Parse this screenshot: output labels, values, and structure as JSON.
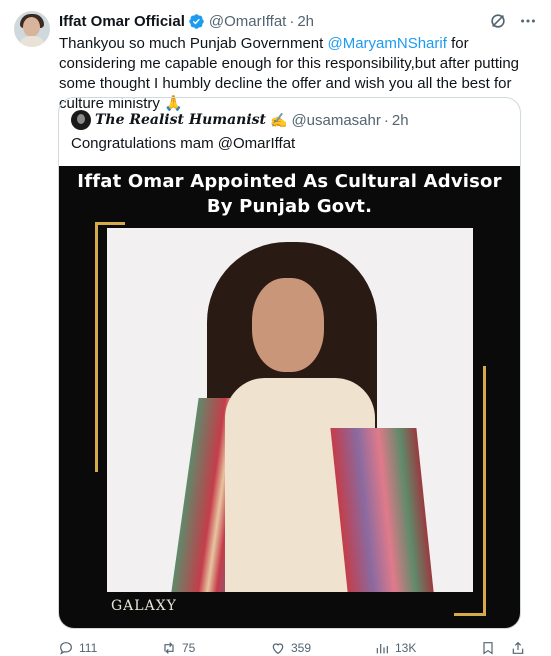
{
  "tweet": {
    "author_name": "Iffat Omar Official",
    "handle": "@OmarIffat",
    "separator": "·",
    "time": "2h",
    "text_before": "Thankyou so much Punjab Government ",
    "mention": "@MaryamNSharif",
    "text_after": " for considering me capable enough for this responsibility,but after putting some thought I humbly decline the offer and wish you all the best for culture ministry 🙏"
  },
  "quote": {
    "author_name": "The Realist Humanist",
    "author_emoji": "✍️",
    "handle": "@usamasahr",
    "separator": "·",
    "time": "2h",
    "text": "Congratulations mam @OmarIffat",
    "image_title_line1": "Iffat Omar Appointed As Cultural Advisor",
    "image_title_line2": "By Punjab Govt.",
    "watermark": "GALAXY"
  },
  "actions": {
    "replies": "111",
    "reposts": "75",
    "likes": "359",
    "views": "13K"
  },
  "colors": {
    "accent": "#1d9bf0",
    "secondary_text": "#536471",
    "gold_frame": "#d4aa4a"
  },
  "icons": [
    "verified-badge-icon",
    "grok-icon",
    "more-icon",
    "reply-icon",
    "repost-icon",
    "like-icon",
    "views-icon",
    "bookmark-icon",
    "share-icon"
  ]
}
